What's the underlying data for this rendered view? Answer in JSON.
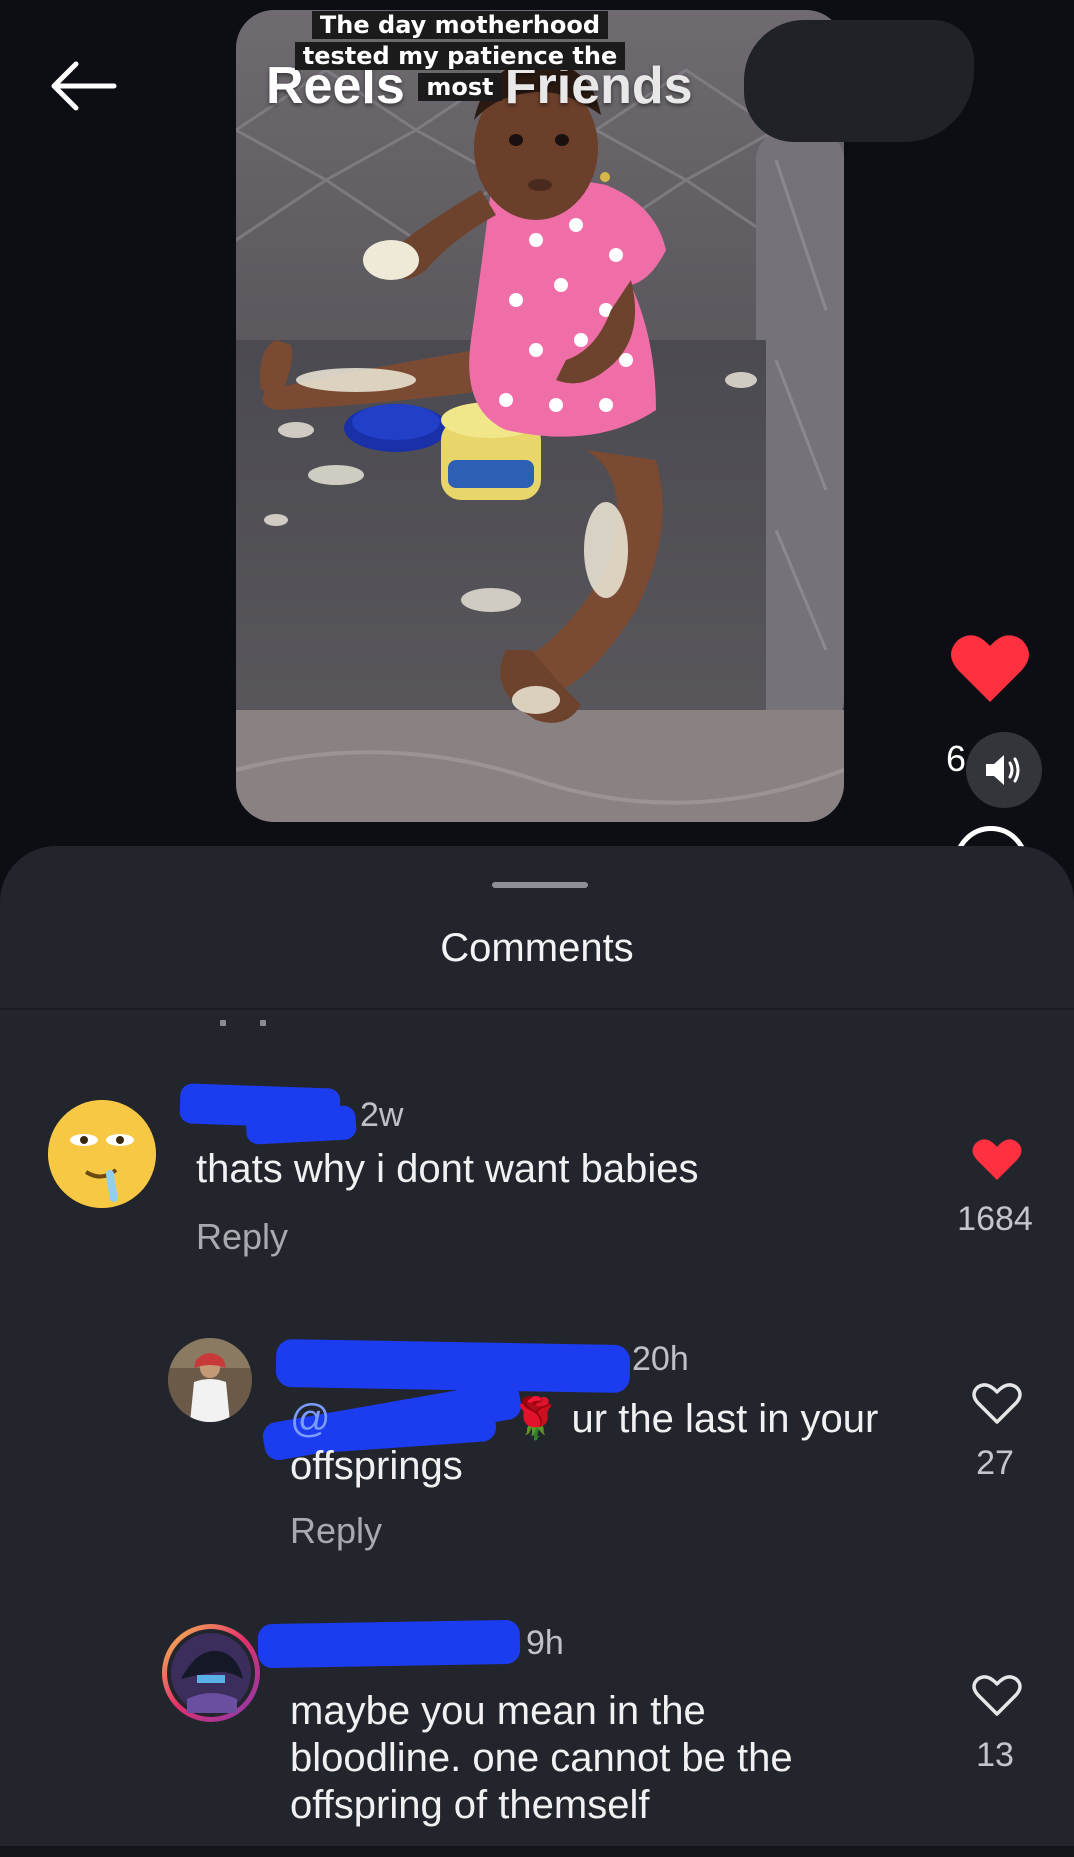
{
  "header": {
    "tabs": [
      {
        "label": "Reels"
      },
      {
        "label": "Friends"
      }
    ],
    "caption_lines": [
      "The day motherhood",
      "tested my patience the",
      "most"
    ]
  },
  "reel": {
    "like_count_partial": "6",
    "like_color": "#ff3040"
  },
  "comments_sheet": {
    "title": "Comments",
    "comments": [
      {
        "time": "2w",
        "text": "thats why i dont want babies",
        "reply_label": "Reply",
        "likes": "1684",
        "liked": true
      },
      {
        "time": "20h",
        "mention_prefix": "@",
        "text_line1": "ur the last in your",
        "text_line2": "offsprings",
        "reply_label": "Reply",
        "likes": "27",
        "liked": false
      },
      {
        "time": "9h",
        "text_lines": [
          "maybe you mean in the",
          "bloodline. one cannot be the",
          "offspring of themself"
        ],
        "likes": "13",
        "liked": false
      }
    ]
  },
  "icons": {
    "back": "arrow-left-icon",
    "heart": "heart-icon",
    "sound": "speaker-icon"
  }
}
